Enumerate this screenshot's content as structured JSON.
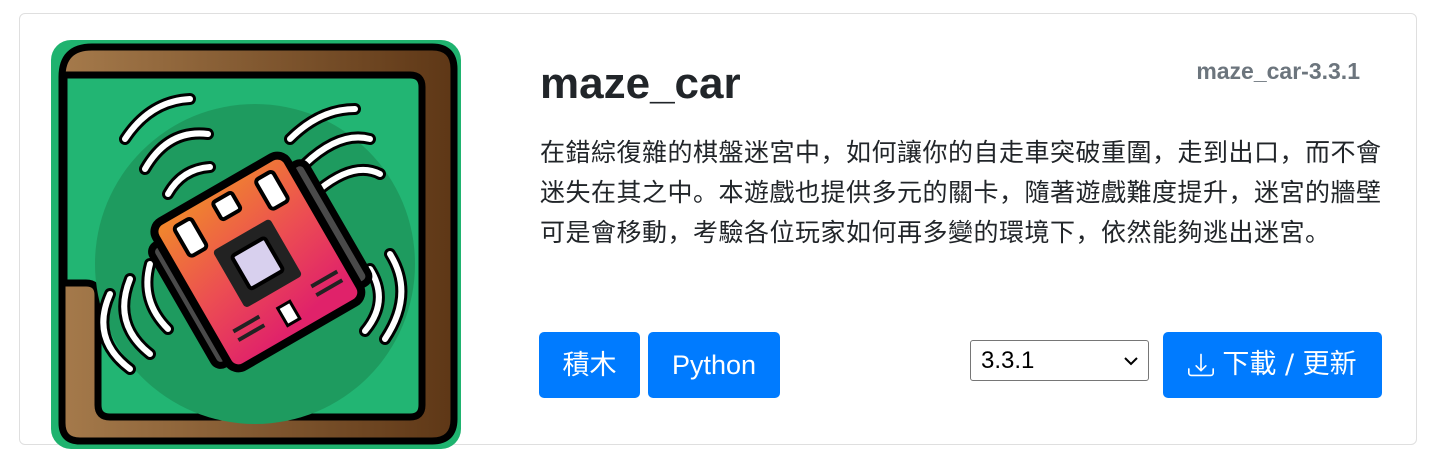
{
  "package": {
    "version_tag": "maze_car-3.3.1",
    "title": "maze_car",
    "description": "在錯綜復雜的棋盤迷宮中，如何讓你的自走車突破重圍，走到出口，而不會迷失在其之中。本遊戲也提供多元的關卡，隨著遊戲難度提升，迷宮的牆壁可是會移動，考驗各位玩家如何再多變的環境下，依然能夠逃出迷宮。",
    "tags": [
      "積木",
      "Python"
    ],
    "selected_version": "3.3.1",
    "download_label": "下載 / 更新"
  },
  "icons": {
    "thumbnail": "maze-car-robot-board-icon",
    "select_arrow": "chevron-down-icon",
    "download": "download-icon"
  },
  "colors": {
    "primary": "#007bff",
    "muted": "#6c757d",
    "text": "#212529",
    "board_green": "#22b573",
    "wall_brown": "#6b3f1d"
  }
}
